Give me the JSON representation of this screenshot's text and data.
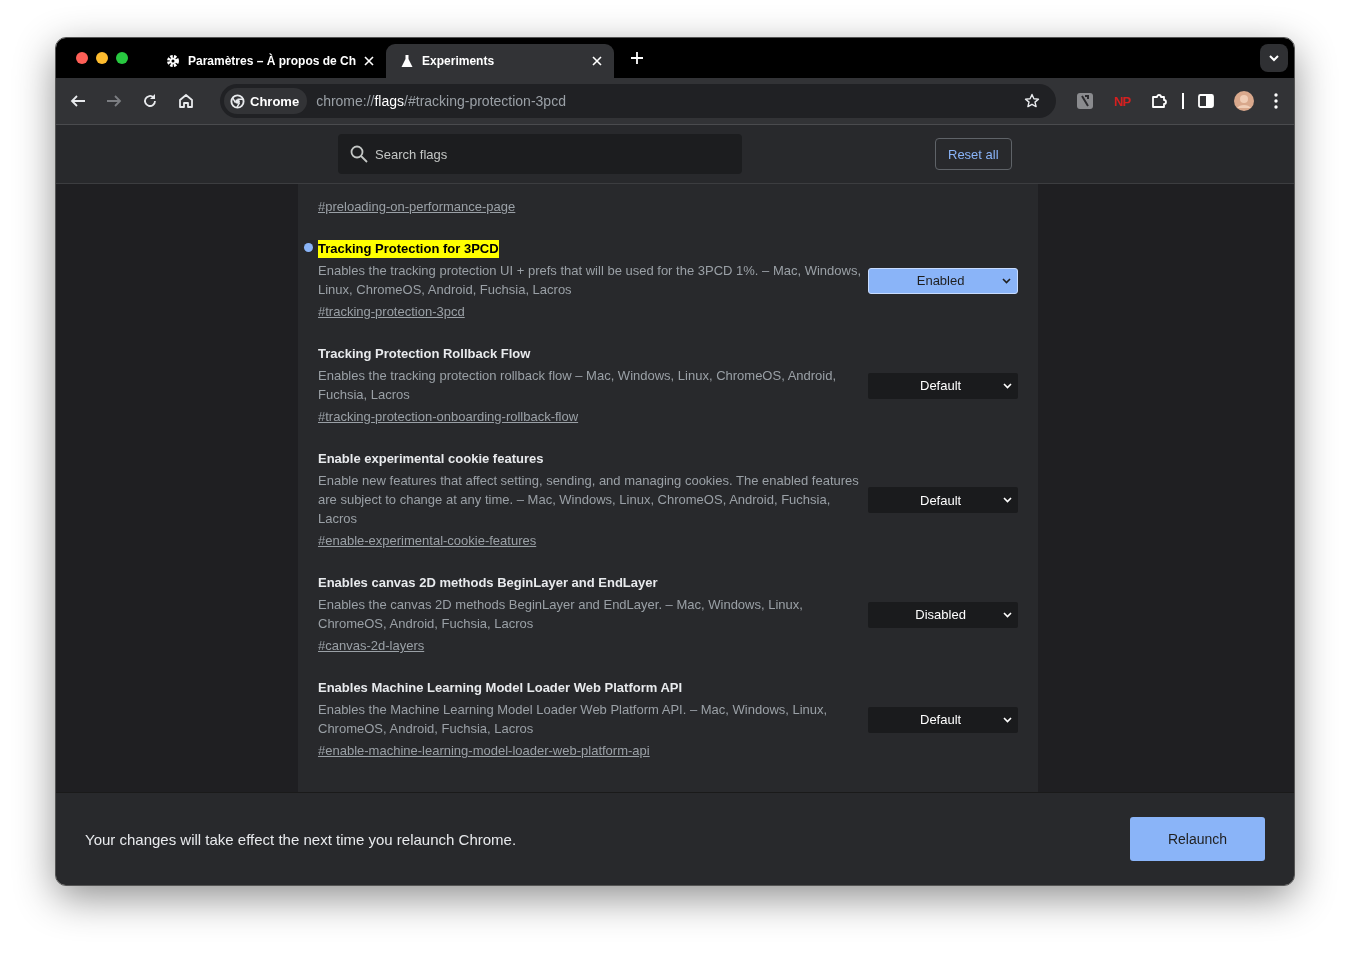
{
  "tabs": [
    {
      "title": "Paramètres – À propos de Ch",
      "selected": false
    },
    {
      "title": "Experiments",
      "selected": true
    }
  ],
  "toolbar": {
    "chip": "Chrome",
    "url_prefix": "chrome://",
    "url_host": "flags",
    "url_path": "/#tracking-protection-3pcd",
    "extension_label": "NP"
  },
  "header": {
    "search_placeholder": "Search flags",
    "reset_button": "Reset all"
  },
  "flags": [
    {
      "link": "#preloading-on-performance-page"
    },
    {
      "title": "Tracking Protection for 3PCD",
      "description": "Enables the tracking protection UI + prefs that will be used for the 3PCD 1%. – Mac, Windows, Linux, ChromeOS, Android, Fuchsia, Lacros",
      "link": "#tracking-protection-3pcd",
      "value": "Enabled",
      "highlighted": true
    },
    {
      "title": "Tracking Protection Rollback Flow",
      "description": "Enables the tracking protection rollback flow – Mac, Windows, Linux, ChromeOS, Android, Fuchsia, Lacros",
      "link": "#tracking-protection-onboarding-rollback-flow",
      "value": "Default",
      "highlighted": false
    },
    {
      "title": "Enable experimental cookie features",
      "description": "Enable new features that affect setting, sending, and managing cookies. The enabled features are subject to change at any time. – Mac, Windows, Linux, ChromeOS, Android, Fuchsia, Lacros",
      "link": "#enable-experimental-cookie-features",
      "value": "Default",
      "highlighted": false
    },
    {
      "title": "Enables canvas 2D methods BeginLayer and EndLayer",
      "description": "Enables the canvas 2D methods BeginLayer and EndLayer. – Mac, Windows, Linux, ChromeOS, Android, Fuchsia, Lacros",
      "link": "#canvas-2d-layers",
      "value": "Disabled",
      "highlighted": false
    },
    {
      "title": "Enables Machine Learning Model Loader Web Platform API",
      "description": "Enables the Machine Learning Model Loader Web Platform API. – Mac, Windows, Linux, ChromeOS, Android, Fuchsia, Lacros",
      "link": "#enable-machine-learning-model-loader-web-platform-api",
      "value": "Default",
      "highlighted": false
    }
  ],
  "footer": {
    "message": "Your changes will take effect the next time you relaunch Chrome.",
    "button": "Relaunch"
  }
}
